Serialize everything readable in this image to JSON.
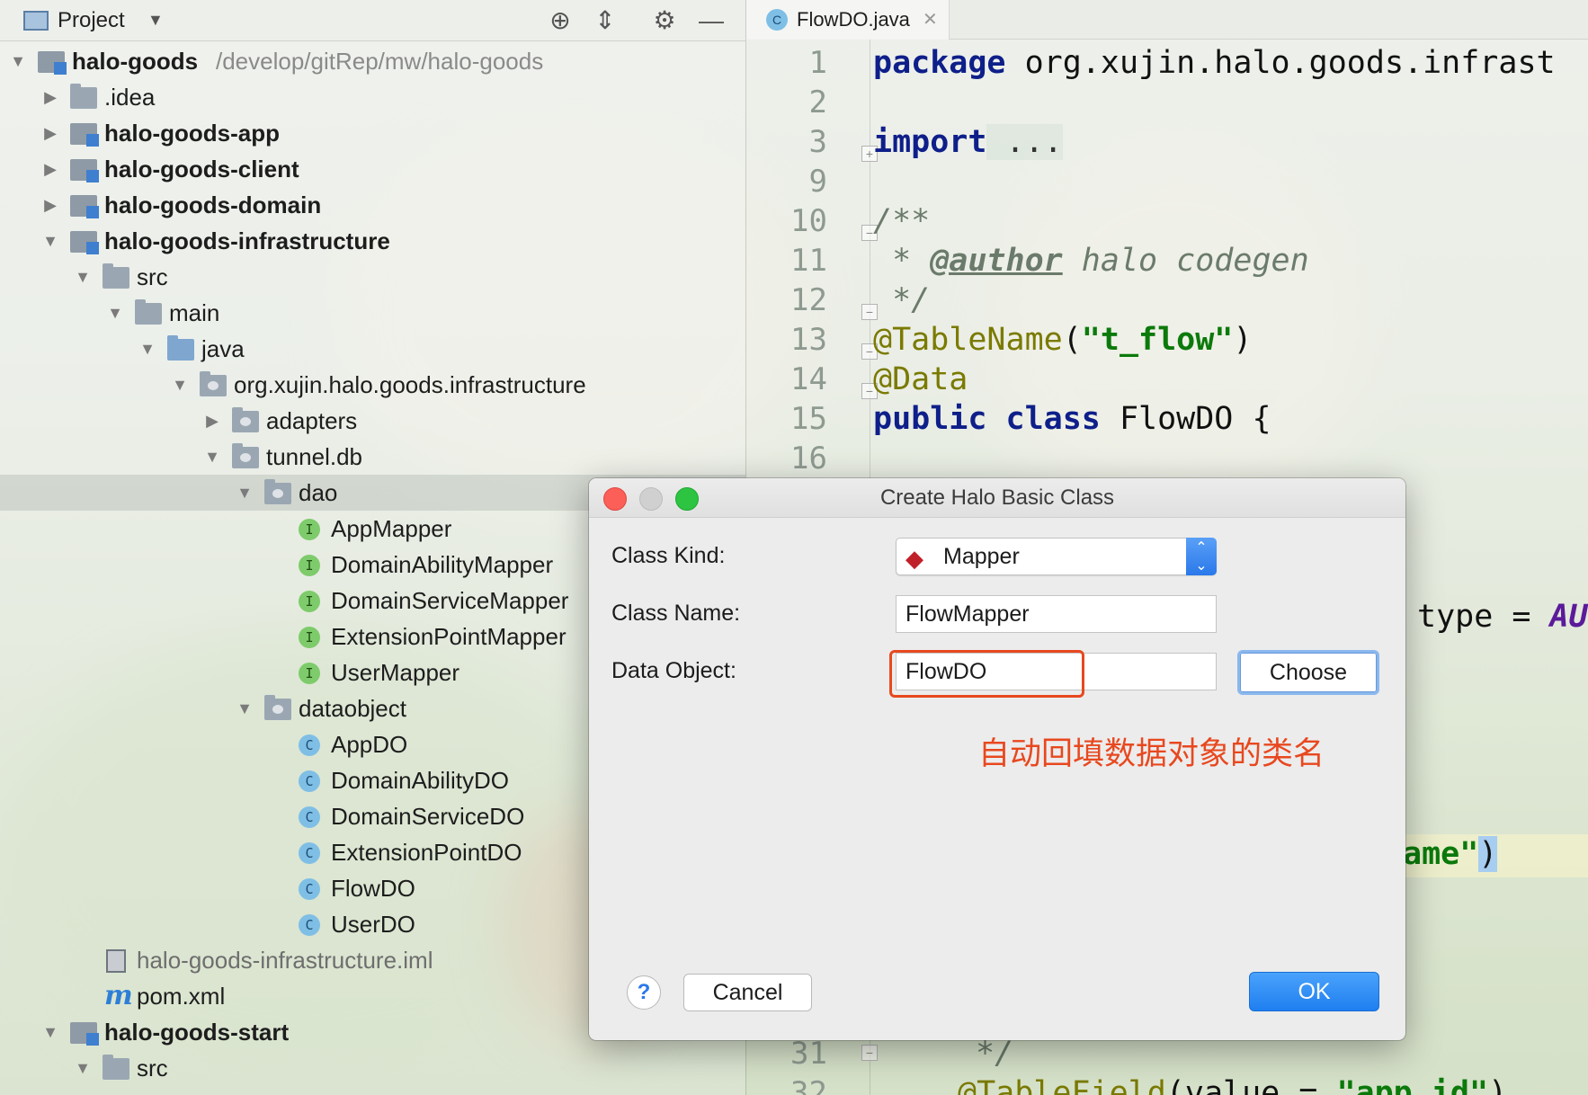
{
  "project_panel": {
    "title": "Project",
    "header_icons": [
      "crosshair-icon",
      "collapse-icon",
      "gear-icon",
      "minimize-icon"
    ],
    "tree": [
      {
        "label": "halo-goods",
        "hint": "/develop/gitRep/mw/halo-goods",
        "level": 0,
        "expanded": true,
        "icon": "module",
        "bold": true
      },
      {
        "label": ".idea",
        "level": 1,
        "expanded": false,
        "icon": "folder"
      },
      {
        "label": "halo-goods-app",
        "level": 1,
        "expanded": false,
        "icon": "module",
        "bold": true
      },
      {
        "label": "halo-goods-client",
        "level": 1,
        "expanded": false,
        "icon": "module",
        "bold": true
      },
      {
        "label": "halo-goods-domain",
        "level": 1,
        "expanded": false,
        "icon": "module",
        "bold": true
      },
      {
        "label": "halo-goods-infrastructure",
        "level": 1,
        "expanded": true,
        "icon": "module",
        "bold": true
      },
      {
        "label": "src",
        "level": 2,
        "expanded": true,
        "icon": "folder"
      },
      {
        "label": "main",
        "level": 3,
        "expanded": true,
        "icon": "folder"
      },
      {
        "label": "java",
        "level": 4,
        "expanded": true,
        "icon": "source-folder"
      },
      {
        "label": "org.xujin.halo.goods.infrastructure",
        "level": 5,
        "expanded": true,
        "icon": "package"
      },
      {
        "label": "adapters",
        "level": 6,
        "expanded": false,
        "icon": "package"
      },
      {
        "label": "tunnel.db",
        "level": 6,
        "expanded": true,
        "icon": "package"
      },
      {
        "label": "dao",
        "level": 7,
        "expanded": true,
        "icon": "package",
        "selected": true
      },
      {
        "label": "AppMapper",
        "level": 8,
        "icon": "interface"
      },
      {
        "label": "DomainAbilityMapper",
        "level": 8,
        "icon": "interface"
      },
      {
        "label": "DomainServiceMapper",
        "level": 8,
        "icon": "interface"
      },
      {
        "label": "ExtensionPointMapper",
        "level": 8,
        "icon": "interface"
      },
      {
        "label": "UserMapper",
        "level": 8,
        "icon": "interface"
      },
      {
        "label": "dataobject",
        "level": 7,
        "expanded": true,
        "icon": "package"
      },
      {
        "label": "AppDO",
        "level": 8,
        "icon": "class"
      },
      {
        "label": "DomainAbilityDO",
        "level": 8,
        "icon": "class"
      },
      {
        "label": "DomainServiceDO",
        "level": 8,
        "icon": "class"
      },
      {
        "label": "ExtensionPointDO",
        "level": 8,
        "icon": "class"
      },
      {
        "label": "FlowDO",
        "level": 8,
        "icon": "class"
      },
      {
        "label": "UserDO",
        "level": 8,
        "icon": "class"
      },
      {
        "label": "halo-goods-infrastructure.iml",
        "level": 2,
        "icon": "iml-file",
        "muted": true
      },
      {
        "label": "pom.xml",
        "level": 2,
        "icon": "maven-file"
      },
      {
        "label": "halo-goods-start",
        "level": 1,
        "expanded": true,
        "icon": "module",
        "bold": true
      },
      {
        "label": "src",
        "level": 2,
        "expanded": true,
        "icon": "folder"
      }
    ]
  },
  "editor": {
    "tab": {
      "label": "FlowDO.java",
      "icon_letter": "C"
    },
    "line_numbers": [
      "1",
      "2",
      "3",
      "9",
      "10",
      "11",
      "12",
      "13",
      "14",
      "15",
      "16"
    ],
    "bottom_line_numbers": [
      "31",
      "32"
    ],
    "code": {
      "l1_kw": "package",
      "l1_rest": " org.xujin.halo.goods.infrast",
      "l3_kw": "import",
      "l3_fold": " ...",
      "l10": "/**",
      "l11_star": " * ",
      "l11_tag": "@author",
      "l11_text": " halo codegen",
      "l12": " */",
      "l13_ann": "@TableName",
      "l13_open": "(",
      "l13_str": "\"t_flow\"",
      "l13_close": ")",
      "l14_ann": "@Data",
      "l15_kw1": "public",
      "l15_kw2": "class",
      "l15_rest": " FlowDO {",
      "peek_type": "type = ",
      "peek_type_val": "AU",
      "peek_ame": "ame\"",
      "peek_paren": ")",
      "l31": "*/",
      "l32_ann": "@TableField",
      "l32_rest": "(value = ",
      "l32_str": "\"app_id\"",
      "l32_close": ")"
    }
  },
  "dialog": {
    "title": "Create Halo Basic Class",
    "class_kind_label": "Class Kind:",
    "class_kind_value": "Mapper",
    "class_name_label": "Class  Name:",
    "class_name_value": "FlowMapper",
    "data_object_label": "Data Object:",
    "data_object_value": "FlowDO",
    "choose_label": "Choose",
    "annotation": "自动回填数据对象的类名",
    "help_label": "?",
    "cancel_label": "Cancel",
    "ok_label": "OK",
    "accent_red": "#e8481f",
    "accent_blue": "#2a78ea"
  }
}
